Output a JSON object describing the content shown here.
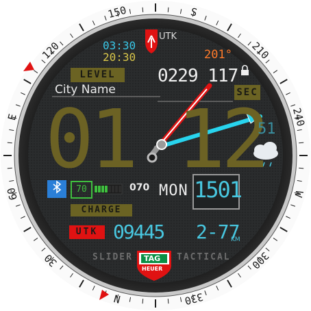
{
  "bezel": {
    "labels": [
      "150",
      "S",
      "210",
      "240",
      "W",
      "300",
      "330",
      "N",
      "30",
      "60",
      "E",
      "120"
    ],
    "marker_color": "#e01212"
  },
  "header": {
    "time_12": "03:30",
    "time_24": "20:30",
    "logo_text": "UTK",
    "temperature": "201°",
    "lock_icon": "padlock-icon"
  },
  "labels": {
    "level": "LEVEL",
    "sec": "SEC",
    "charge": "CHARGE",
    "utk": "UTK",
    "slider": "SLIDER",
    "tactical": "TACTICAL",
    "brand_tag": "TAG",
    "brand_heuer": "HEUER"
  },
  "info": {
    "city": "City Name",
    "steps": "0229 117",
    "hour": "01",
    "minute": "12",
    "seconds": "51",
    "battery_value": "70",
    "heart_rate": "070",
    "day_of_week": "MON",
    "date": "1501",
    "calories": "09445",
    "distance": "2-77",
    "distance_unit": "KM",
    "battery_level": 0.4
  },
  "icons": {
    "bluetooth": "bluetooth-icon",
    "weather": "cloud-rain-icon",
    "lock": "padlock-icon"
  },
  "colors": {
    "olive": "#6c6224",
    "cyan": "#48c7e0",
    "red": "#e01212",
    "green": "#3fbf3f",
    "orange": "#ff7a2a"
  }
}
